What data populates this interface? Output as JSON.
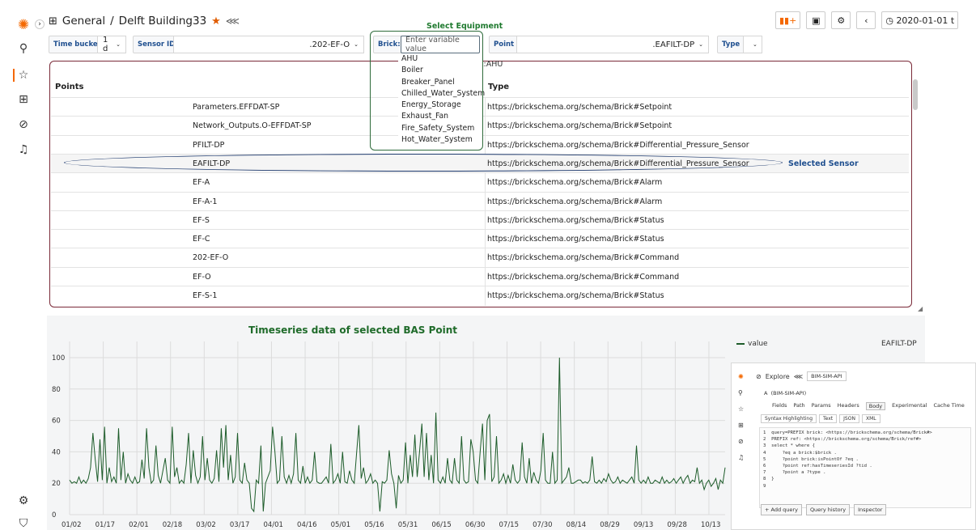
{
  "header": {
    "breadcrumb_root": "General",
    "breadcrumb_sep": "/",
    "dashboard": "Delft Building33",
    "time_range": "2020-01-01 t"
  },
  "variables": {
    "time_bucket_label": "Time bucket",
    "time_bucket_value": "1 d",
    "sensor_id_label": "Sensor ID",
    "sensor_id_value": ".202-EF-O",
    "brick_label": "Brick:",
    "brick_placeholder": "Enter variable value",
    "point_label": "Point",
    "point_value": ".EAFILT-DP",
    "type_label": "Type"
  },
  "annotations": {
    "select_equipment": "Select Equipment",
    "selected_sensor": "Selected Sensor",
    "ahu_chip": "k:AHU"
  },
  "brick_options": [
    "AHU",
    "Boiler",
    "Breaker_Panel",
    "Chilled_Water_System",
    "Energy_Storage",
    "Exhaust_Fan",
    "Fire_Safety_System",
    "Hot_Water_System"
  ],
  "table": {
    "col_points": "Points",
    "col_type": "Type",
    "rows": [
      {
        "point": "Parameters.EFFDAT-SP",
        "type": "https://brickschema.org/schema/Brick#Setpoint"
      },
      {
        "point": "Network_Outputs.O-EFFDAT-SP",
        "type": "https://brickschema.org/schema/Brick#Setpoint"
      },
      {
        "point": "PFILT-DP",
        "type": "https://brickschema.org/schema/Brick#Differential_Pressure_Sensor"
      },
      {
        "point": "EAFILT-DP",
        "type": "https://brickschema.org/schema/Brick#Differential_Pressure_Sensor"
      },
      {
        "point": "EF-A",
        "type": "https://brickschema.org/schema/Brick#Alarm"
      },
      {
        "point": "EF-A-1",
        "type": "https://brickschema.org/schema/Brick#Alarm"
      },
      {
        "point": "EF-S",
        "type": "https://brickschema.org/schema/Brick#Status"
      },
      {
        "point": "EF-C",
        "type": "https://brickschema.org/schema/Brick#Status"
      },
      {
        "point": "202-EF-O",
        "type": "https://brickschema.org/schema/Brick#Command"
      },
      {
        "point": "EF-O",
        "type": "https://brickschema.org/schema/Brick#Command"
      },
      {
        "point": "EF-S-1",
        "type": "https://brickschema.org/schema/Brick#Status"
      }
    ]
  },
  "chart_data": {
    "type": "line",
    "title": "Timeseries data of selected BAS Point",
    "legend_label": "value",
    "legend_right": "EAFILT-DP",
    "legend_position": "top-right",
    "grid": true,
    "ylim": [
      0,
      100
    ],
    "yticks": [
      0,
      20,
      40,
      60,
      80,
      100
    ],
    "xticks": [
      "01/02",
      "01/17",
      "02/01",
      "02/18",
      "03/02",
      "03/17",
      "04/01",
      "04/16",
      "05/01",
      "05/16",
      "05/31",
      "06/15",
      "06/30",
      "07/15",
      "07/30",
      "08/14",
      "08/29",
      "09/13",
      "09/28",
      "10/13"
    ],
    "series": [
      {
        "name": "value",
        "color": "#1d5c2a",
        "values": [
          22,
          20,
          21,
          20,
          24,
          20,
          22,
          20,
          23,
          30,
          52,
          35,
          21,
          48,
          22,
          56,
          20,
          30,
          21,
          24,
          20,
          55,
          22,
          40,
          20,
          26,
          22,
          20,
          24,
          20,
          21,
          35,
          23,
          55,
          30,
          20,
          22,
          44,
          25,
          20,
          28,
          36,
          22,
          20,
          56,
          24,
          30,
          20,
          22,
          20,
          32,
          52,
          20,
          41,
          25,
          20,
          24,
          50,
          22,
          36,
          22,
          20,
          23,
          41,
          21,
          55,
          30,
          57,
          22,
          38,
          20,
          24,
          52,
          22,
          20,
          33,
          22,
          20,
          4,
          2,
          22,
          20,
          44,
          2,
          20,
          24,
          28,
          56,
          40,
          20,
          22,
          50,
          24,
          20,
          25,
          20,
          26,
          52,
          22,
          20,
          31,
          20,
          24,
          20,
          22,
          40,
          21,
          20,
          20,
          22,
          24,
          20,
          45,
          20,
          22,
          26,
          20,
          40,
          21,
          20,
          28,
          22,
          20,
          39,
          57,
          23,
          30,
          20,
          22,
          26,
          20,
          22,
          20,
          2,
          21,
          20,
          22,
          41,
          26,
          20,
          4,
          25,
          20,
          22,
          46,
          20,
          38,
          24,
          51,
          24,
          40,
          58,
          24,
          52,
          22,
          38,
          20,
          65,
          22,
          20,
          24,
          20,
          36,
          22,
          20,
          36,
          22,
          20,
          50,
          22,
          20,
          21,
          48,
          40,
          22,
          20,
          40,
          58,
          22,
          60,
          64,
          21,
          24,
          50,
          20,
          22,
          26,
          20,
          25,
          20,
          32,
          22,
          20,
          22,
          46,
          24,
          20,
          36,
          20,
          27,
          22,
          20,
          28,
          52,
          22,
          20,
          20,
          40,
          20,
          22,
          100,
          20,
          22,
          24,
          30,
          20,
          20,
          21,
          22,
          22,
          20,
          21,
          20,
          22,
          37,
          21,
          20,
          22,
          20,
          23,
          21,
          26,
          22,
          20,
          21,
          24,
          20,
          22,
          21,
          20,
          22,
          24,
          20,
          44,
          22,
          20,
          22,
          20,
          24,
          20,
          20,
          22,
          21,
          20,
          24,
          20,
          22,
          20,
          21,
          23,
          20,
          22,
          24,
          20,
          23,
          25,
          20,
          22,
          21,
          30,
          20,
          22,
          16,
          20,
          22,
          18,
          20,
          23,
          16,
          22,
          20,
          30
        ]
      }
    ]
  },
  "explore": {
    "title": "Explore",
    "datasource": "BIM-SIM-API",
    "query_label": "A",
    "query_hint": "(BIM-SIM-API)",
    "tabs": [
      "Fields",
      "Path",
      "Params",
      "Headers",
      "Body",
      "Experimental",
      "Cache Time"
    ],
    "subtabs": [
      "Syntax Highlighting",
      "Text",
      "JSON",
      "XML"
    ],
    "code": "1  query=PREFIX brick: <https://brickschema.org/schema/Brick#>\n2  PREFIX ref: <https://brickschema.org/schema/Brick/ref#>\n3  select * where {\n4      ?eq a brick:$brick .\n5      ?point brick:isPointOf ?eq .\n6      ?point ref:hasTimeseriesId ?tid .\n7      ?point a ?type .\n8  }\n9",
    "buttons": [
      "+ Add query",
      "Query history",
      "Inspector"
    ]
  }
}
